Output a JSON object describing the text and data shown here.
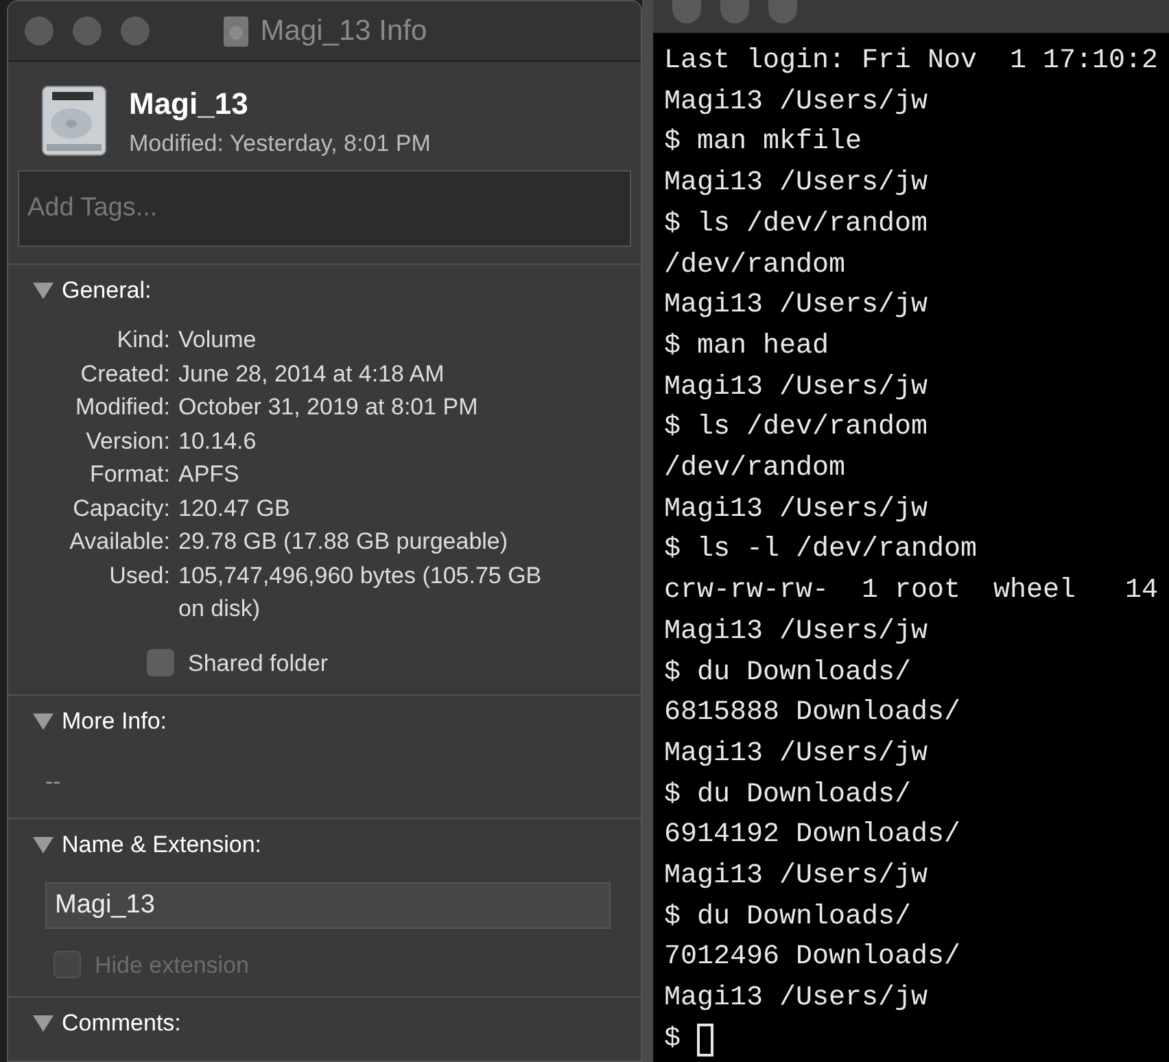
{
  "info_window": {
    "title": "Magi_13 Info",
    "name": "Magi_13",
    "modified": "Modified: Yesterday, 8:01 PM",
    "tags": {
      "placeholder": "Add Tags..."
    },
    "sections": [
      {
        "kind": "general",
        "title": "General:",
        "expanded": true,
        "rows": [
          {
            "label": "Kind:",
            "value": "Volume"
          },
          {
            "label": "Created:",
            "value": "June 28, 2014 at 4:18 AM"
          },
          {
            "label": "Modified:",
            "value": "October 31, 2019 at 8:01 PM"
          },
          {
            "label": "Version:",
            "value": "10.14.6"
          },
          {
            "label": "Format:",
            "value": "APFS"
          },
          {
            "label": "Capacity:",
            "value": "120.47 GB"
          },
          {
            "label": "Available:",
            "value": "29.78 GB (17.88 GB purgeable)"
          },
          {
            "label": "Used:",
            "value": "105,747,496,960 bytes (105.75 GB on disk)"
          }
        ],
        "checkbox": {
          "label": "Shared folder",
          "checked": false,
          "disabled": false
        }
      },
      {
        "kind": "text",
        "title": "More Info:",
        "expanded": true,
        "text": "--"
      },
      {
        "kind": "name",
        "title": "Name & Extension:",
        "expanded": true,
        "value": "Magi_13",
        "checkbox": {
          "label": "Hide extension",
          "checked": false,
          "disabled": true
        }
      },
      {
        "kind": "empty",
        "title": "Comments:",
        "expanded": true
      }
    ]
  },
  "terminal": {
    "lines": [
      "Last login: Fri Nov  1 17:10:2",
      "Magi13 /Users/jw",
      "$ man mkfile",
      "Magi13 /Users/jw",
      "$ ls /dev/random",
      "/dev/random",
      "Magi13 /Users/jw",
      "$ man head",
      "Magi13 /Users/jw",
      "$ ls /dev/random",
      "/dev/random",
      "Magi13 /Users/jw",
      "$ ls -l /dev/random",
      "crw-rw-rw-  1 root  wheel   14",
      "Magi13 /Users/jw",
      "$ du Downloads/",
      "6815888 Downloads/",
      "Magi13 /Users/jw",
      "$ du Downloads/",
      "6914192 Downloads/",
      "Magi13 /Users/jw",
      "$ du Downloads/",
      "7012496 Downloads/",
      "Magi13 /Users/jw",
      "$"
    ]
  }
}
